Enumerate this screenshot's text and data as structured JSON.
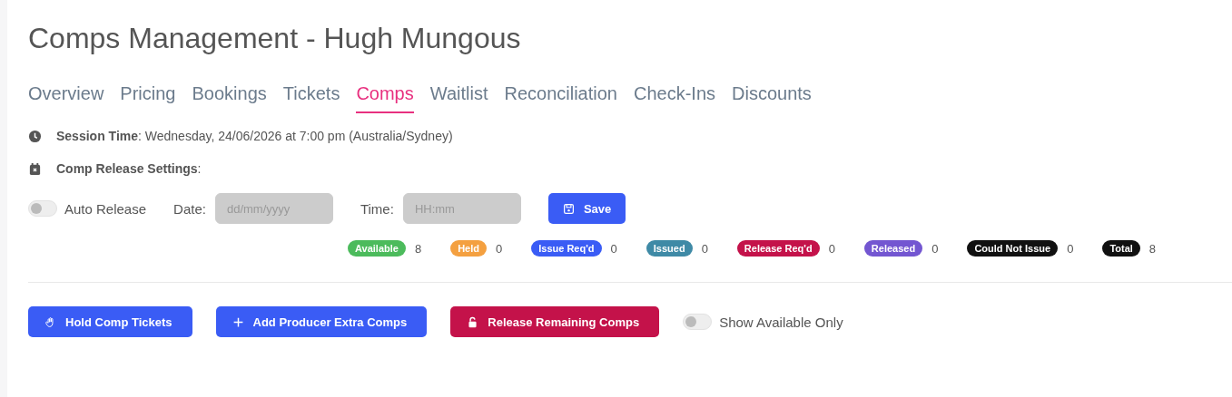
{
  "title": "Comps Management - Hugh Mungous",
  "tabs": [
    {
      "label": "Overview",
      "selected": false
    },
    {
      "label": "Pricing",
      "selected": false
    },
    {
      "label": "Bookings",
      "selected": false
    },
    {
      "label": "Tickets",
      "selected": false
    },
    {
      "label": "Comps",
      "selected": true
    },
    {
      "label": "Waitlist",
      "selected": false
    },
    {
      "label": "Reconciliation",
      "selected": false
    },
    {
      "label": "Check-Ins",
      "selected": false
    },
    {
      "label": "Discounts",
      "selected": false
    }
  ],
  "session": {
    "label": "Session Time",
    "value": ": Wednesday, 24/06/2026 at 7:00 pm (Australia/Sydney)"
  },
  "release_settings": {
    "label": "Comp Release Settings",
    "suffix": ":"
  },
  "auto_release": {
    "label": "Auto Release",
    "on": false
  },
  "date": {
    "label": "Date:",
    "placeholder": "dd/mm/yyyy",
    "disabled": true
  },
  "time": {
    "label": "Time:",
    "placeholder": "HH:mm",
    "disabled": true
  },
  "save_button": "Save",
  "statuses": [
    {
      "label": "Available",
      "count": "8",
      "color": "#4cbb5c"
    },
    {
      "label": "Held",
      "count": "0",
      "color": "#f4a040"
    },
    {
      "label": "Issue Req'd",
      "count": "0",
      "color": "#3a5cf5"
    },
    {
      "label": "Issued",
      "count": "0",
      "color": "#3f8aa6"
    },
    {
      "label": "Release Req'd",
      "count": "0",
      "color": "#c4124a"
    },
    {
      "label": "Released",
      "count": "0",
      "color": "#7356d1"
    },
    {
      "label": "Could Not Issue",
      "count": "0",
      "color": "#111111"
    },
    {
      "label": "Total",
      "count": "8",
      "color": "#111111"
    }
  ],
  "actions": [
    {
      "kind": "hold",
      "label": "Hold Comp Tickets"
    },
    {
      "kind": "add",
      "label": "Add Producer Extra Comps"
    },
    {
      "kind": "release",
      "label": "Release Remaining Comps"
    }
  ],
  "show_available_only": {
    "label": "Show Available Only",
    "on": false
  }
}
